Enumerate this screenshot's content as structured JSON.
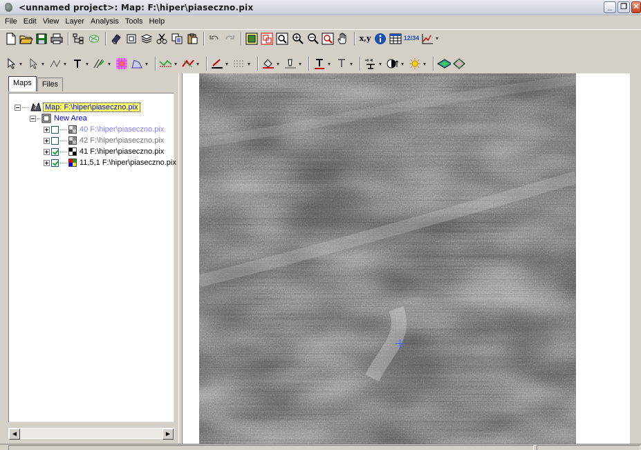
{
  "window": {
    "title": "<unnamed project>: Map: F:\\hiper\\piaseczno.pix"
  },
  "menubar": {
    "items": [
      "File",
      "Edit",
      "View",
      "Layer",
      "Analysis",
      "Tools",
      "Help"
    ]
  },
  "toolbar1": {
    "icons": [
      "new-file-icon",
      "open-folder-icon",
      "save-icon",
      "print-icon",
      "tree-icon",
      "hatch-icon",
      "eraser-icon",
      "box-icon",
      "layers-icon",
      "cut-icon",
      "copy-icon",
      "paste-icon",
      "undo-icon",
      "redo-icon",
      "zoom-extent-icon",
      "zoom-layer-icon",
      "zoom-box-icon",
      "zoom-in-icon",
      "zoom-out-icon",
      "zoom-select-icon",
      "pan-hand-icon",
      "coordinates-icon",
      "info-icon",
      "table-icon",
      "numbers-icon",
      "chart-icon"
    ],
    "coordinates_label": "x,y",
    "numbers_label": "12/34"
  },
  "toolbar2": {
    "icons": [
      "select-arrow-icon",
      "select-point-icon",
      "line-tool-icon",
      "text-tool-icon",
      "polyline-tool-icon",
      "raster-edit-icon",
      "polygon-tool-icon",
      "line-style-icon",
      "vector-style-icon",
      "line-width-icon",
      "dash-style-icon",
      "fill-color-icon",
      "line-color-icon",
      "font-icon",
      "text-color-icon",
      "legend-icon",
      "contrast-icon",
      "brightness-icon",
      "layer-view-icon",
      "palette-icon"
    ]
  },
  "left_panel": {
    "tabs": [
      {
        "label": "Maps",
        "active": true
      },
      {
        "label": "Files",
        "active": false
      }
    ],
    "tree": {
      "map_label": "Map: F:\\hiper\\piaseczno.pix",
      "area_label": "New Area",
      "layers": [
        {
          "label": "40 F:\\hiper\\piaseczno.pix",
          "checked": false,
          "style": "dim"
        },
        {
          "label": "42 F:\\hiper\\piaseczno.pix",
          "checked": false,
          "style": "gray"
        },
        {
          "label": "41 F:\\hiper\\piaseczno.pix",
          "checked": true,
          "style": "normal"
        },
        {
          "label": "11,5,1 F:\\hiper\\piaseczno.pix",
          "checked": true,
          "style": "normal"
        }
      ]
    }
  },
  "colors": {
    "tree_highlight": "#ffff66",
    "link_blue": "#0000cc",
    "dim_blue": "#8080ff",
    "crosshair": "#4060ff"
  }
}
